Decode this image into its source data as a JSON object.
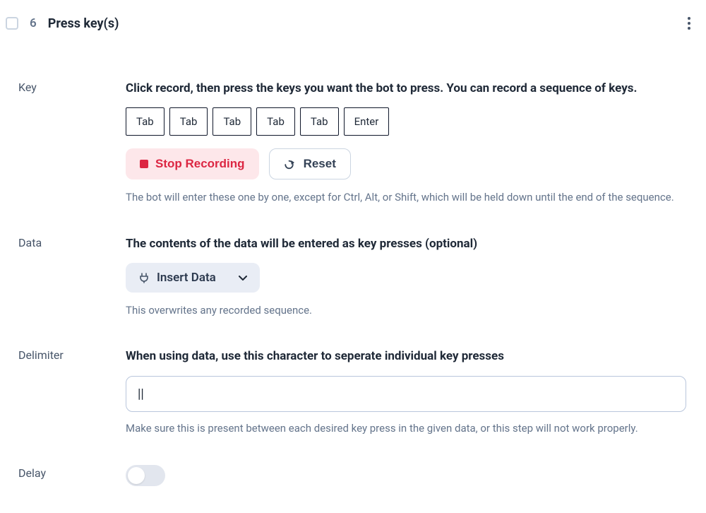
{
  "header": {
    "step_number": "6",
    "title": "Press key(s)"
  },
  "key_section": {
    "label": "Key",
    "description": "Click record, then press the keys you want the bot to press. You can record a sequence of keys.",
    "keys": [
      "Tab",
      "Tab",
      "Tab",
      "Tab",
      "Tab",
      "Enter"
    ],
    "stop_label": "Stop Recording",
    "reset_label": "Reset",
    "help": "The bot will enter these one by one, except for Ctrl, Alt, or Shift, which will be held down until the end of the sequence."
  },
  "data_section": {
    "label": "Data",
    "description": "The contents of the data will be entered as key presses (optional)",
    "insert_label": "Insert Data",
    "help": "This overwrites any recorded sequence."
  },
  "delimiter_section": {
    "label": "Delimiter",
    "description": "When using data, use this character to seperate individual key presses",
    "value": "||",
    "help": "Make sure this is present between each desired key press in the given data, or this step will not work properly."
  },
  "delay_section": {
    "label": "Delay",
    "enabled": false
  }
}
